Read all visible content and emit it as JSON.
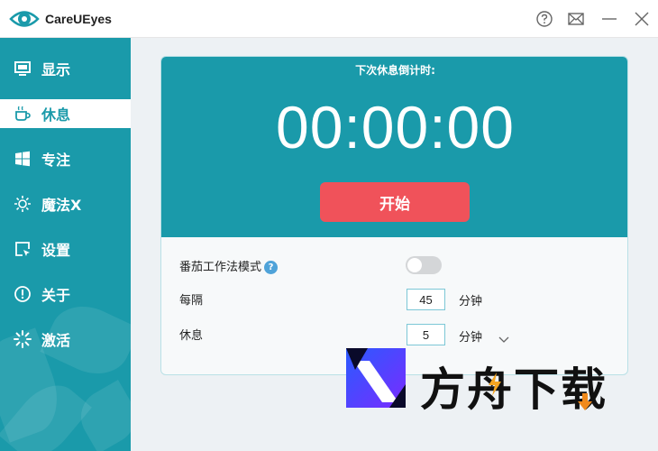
{
  "window": {
    "title": "CareUEyes",
    "controls": {
      "help": "help-icon",
      "feedback": "mail-icon",
      "minimize": "minimize-icon",
      "close": "close-icon"
    }
  },
  "sidebar": {
    "items": [
      {
        "label": "显示",
        "icon": "monitor-icon",
        "active": false
      },
      {
        "label": "休息",
        "icon": "coffee-cup-icon",
        "active": true
      },
      {
        "label": "专注",
        "icon": "windows-icon",
        "active": false
      },
      {
        "label": "魔法X",
        "icon": "sun-icon",
        "active": false
      },
      {
        "label": "设置",
        "icon": "cursor-window-icon",
        "active": false
      },
      {
        "label": "关于",
        "icon": "info-icon",
        "active": false
      },
      {
        "label": "激活",
        "icon": "sparkle-icon",
        "active": false
      }
    ]
  },
  "timer": {
    "label": "下次休息倒计时:",
    "time": "00:00:00",
    "start_label": "开始"
  },
  "settings": {
    "pomodoro": {
      "label": "番茄工作法模式",
      "help": "?",
      "enabled": false
    },
    "interval": {
      "label": "每隔",
      "value": "45",
      "unit": "分钟"
    },
    "rest": {
      "label": "休息",
      "value": "5",
      "unit": "分钟"
    }
  },
  "watermark": {
    "text": "方舟下载"
  },
  "colors": {
    "accent": "#1a9aaa",
    "start_button": "#f0525a",
    "help_badge": "#4fa3d9"
  }
}
